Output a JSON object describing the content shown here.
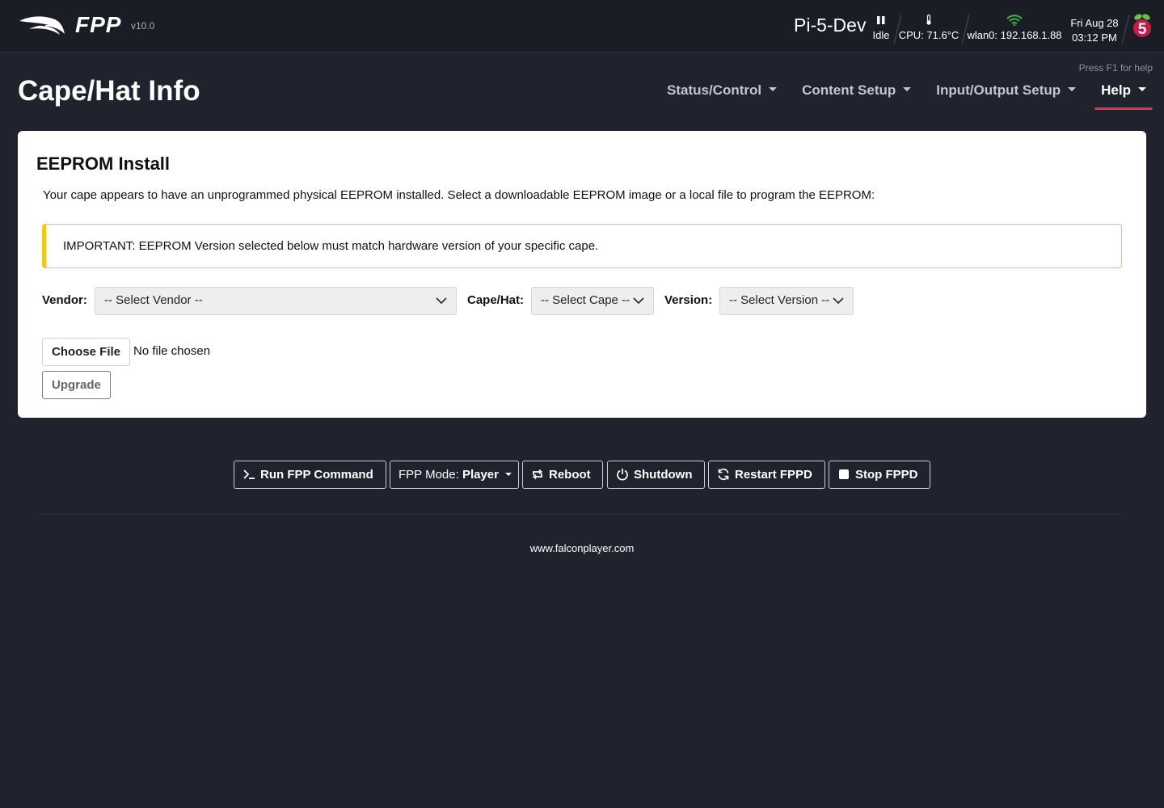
{
  "header": {
    "brand": "FPP",
    "version": "v10.0",
    "hostname": "Pi-5-Dev",
    "status": {
      "label": "Idle",
      "icon": "pause-icon"
    },
    "cpu": {
      "label": "CPU: 71.6°C",
      "icon": "thermometer-icon"
    },
    "network": {
      "label": "wlan0: 192.168.1.88",
      "icon": "wifi-icon",
      "color": "#3bb54a"
    },
    "date": "Fri Aug 28",
    "time": "03:12 PM",
    "board_icon": "raspberry-pi-icon",
    "board_number": "5"
  },
  "help_hint": "Press F1 for help",
  "page_title": "Cape/Hat Info",
  "nav": [
    {
      "label": "Status/Control",
      "active": false
    },
    {
      "label": "Content Setup",
      "active": false
    },
    {
      "label": "Input/Output Setup",
      "active": false
    },
    {
      "label": "Help",
      "active": true
    }
  ],
  "accent_color": "#e0344d",
  "card": {
    "title": "EEPROM Install",
    "description": "Your cape appears to have an unprogrammed physical EEPROM installed. Select a downloadable EEPROM image or a local file to program the EEPROM:",
    "alert": "IMPORTANT: EEPROM Version selected below must match hardware version of your specific cape.",
    "alert_color": "#f3c516",
    "vendor_label": "Vendor:",
    "vendor_value": "-- Select Vendor --",
    "cape_label": "Cape/Hat:",
    "cape_value": "-- Select Cape --",
    "version_label": "Version:",
    "version_value": "-- Select Version --",
    "choose_file_label": "Choose File",
    "no_file_text": "No file chosen",
    "upgrade_label": "Upgrade"
  },
  "commands": {
    "run_command": "Run FPP Command",
    "mode_prefix": "FPP Mode:",
    "mode_value": "Player",
    "reboot": "Reboot",
    "shutdown": "Shutdown",
    "restart": "Restart FPPD",
    "stop": "Stop FPPD"
  },
  "footer_link": "www.falconplayer.com"
}
